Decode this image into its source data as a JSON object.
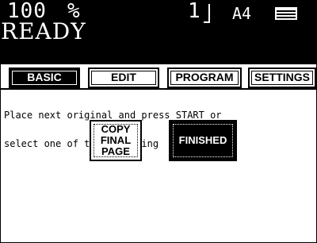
{
  "header": {
    "quantity": "100",
    "percent": "%",
    "count": "1",
    "paper_size": "A4",
    "tray_icon": "paper-tray-icon",
    "status": "READY"
  },
  "tabs": [
    {
      "label": "BASIC",
      "active": true
    },
    {
      "label": "EDIT",
      "active": false
    },
    {
      "label": "PROGRAM",
      "active": false
    },
    {
      "label": "SETTINGS",
      "active": false
    }
  ],
  "message": {
    "line1": "Place next original and press START or",
    "line2": "select one of the following"
  },
  "buttons": {
    "copy_final_page": {
      "line1": "COPY",
      "line2": "FINAL",
      "line3": "PAGE"
    },
    "finished": {
      "label": "FINISHED"
    }
  },
  "colors": {
    "background": "#ffffff",
    "foreground": "#000000"
  }
}
